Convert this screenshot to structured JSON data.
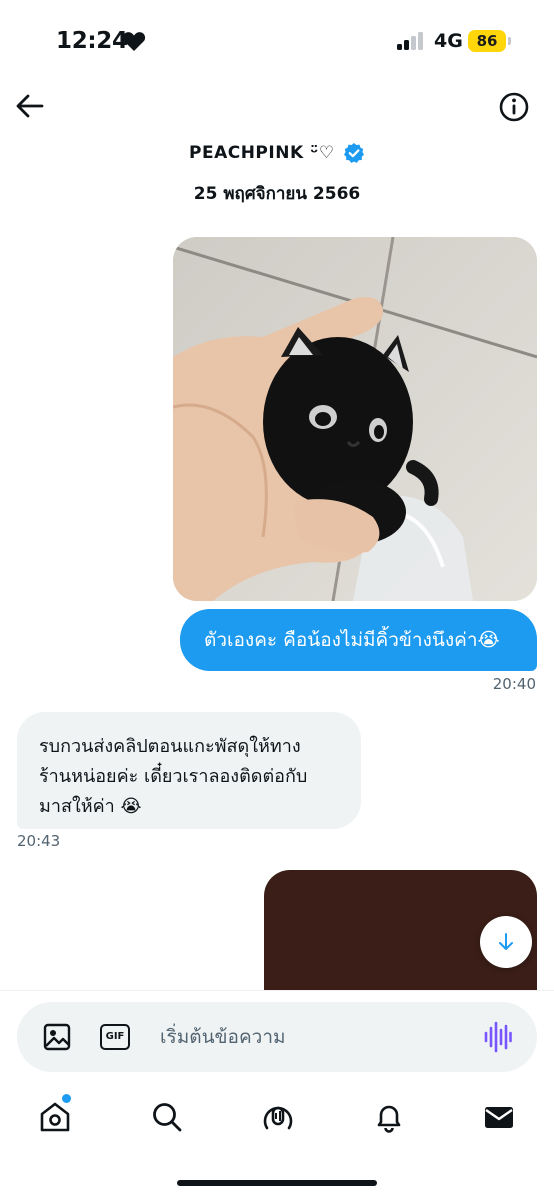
{
  "status_bar": {
    "time": "12:24",
    "network": "4G",
    "battery": "86",
    "battery_color": "#ffd60a"
  },
  "header": {
    "title": "PEACHPINK ᵕ̈♡",
    "verified_color": "#1d9bf0",
    "back_icon": "arrow-left-icon",
    "info_icon": "info-icon"
  },
  "conversation": {
    "date": "25 พฤศจิกายน 2566",
    "messages": [
      {
        "direction": "outgoing",
        "type": "image"
      },
      {
        "direction": "outgoing",
        "type": "text",
        "text": "ตัวเองคะ คือน้องไม่มีคิ้วข้างนึงค่า😭",
        "time": "20:40"
      },
      {
        "direction": "incoming",
        "type": "text",
        "lines": [
          "รบกวนส่งคลิปตอนแกะพัสดุให้ทาง",
          "ร้านหน่อยค่ะ เดี๋ยวเราลองติดต่อกับ",
          "มาสให้ค่า 😭"
        ],
        "time": "20:43"
      },
      {
        "direction": "outgoing",
        "type": "image"
      }
    ],
    "outgoing_bubble_color": "#1d9bf0",
    "incoming_bubble_color": "#eff3f4"
  },
  "composer": {
    "placeholder": "เริ่มต้นข้อความ",
    "gif_label": "GIF",
    "image_icon": "image-icon",
    "voice_icon": "voice-waveform-icon",
    "voice_color": "#7856ff"
  },
  "bottom_nav": {
    "items": [
      "home-icon",
      "search-icon",
      "spaces-icon",
      "bell-icon",
      "mail-icon"
    ],
    "active": "mail-icon"
  }
}
